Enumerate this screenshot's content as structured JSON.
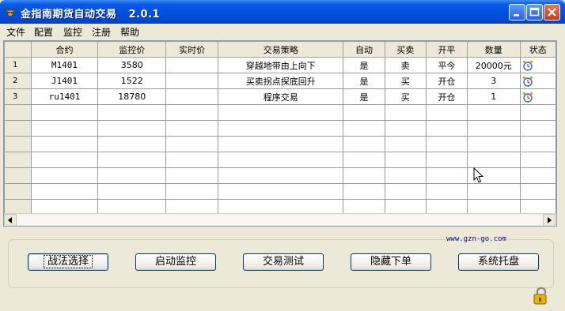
{
  "window": {
    "title": "金指南期货自动交易   2.0.1",
    "url": "www.gzn-go.com"
  },
  "menu": [
    "文件",
    "配置",
    "监控",
    "注册",
    "帮助"
  ],
  "table": {
    "columns": [
      "合约",
      "监控价",
      "实时价",
      "交易策略",
      "自动",
      "买卖",
      "开平",
      "数量",
      "状态"
    ],
    "rows": [
      {
        "num": "1",
        "contract": "M1401",
        "monitor_price": "3580",
        "realtime_price": "",
        "strategy": "穿越地带由上向下",
        "auto": "是",
        "side": "卖",
        "openclose": "平今",
        "qty": "20000元"
      },
      {
        "num": "2",
        "contract": "J1401",
        "monitor_price": "1522",
        "realtime_price": "",
        "strategy": "买卖拐点探底回升",
        "auto": "是",
        "side": "买",
        "openclose": "开仓",
        "qty": "3"
      },
      {
        "num": "3",
        "contract": "ru1401",
        "monitor_price": "18780",
        "realtime_price": "",
        "strategy": "程序交易",
        "auto": "是",
        "side": "买",
        "openclose": "开仓",
        "qty": "1"
      }
    ],
    "empty_rows": 7
  },
  "buttons": {
    "strategy": "战法选择",
    "start_monitor": "启动监控",
    "trade_test": "交易测试",
    "hide_order": "隐藏下单",
    "system_tray": "系统托盘"
  },
  "colors": {
    "titlebar": "#0052e0",
    "url_text": "#000080",
    "window_bg": "#ece9d8"
  },
  "icons": {
    "status": "alarm-clock-icon",
    "app": "bull-icon",
    "lock": "lock-icon"
  }
}
